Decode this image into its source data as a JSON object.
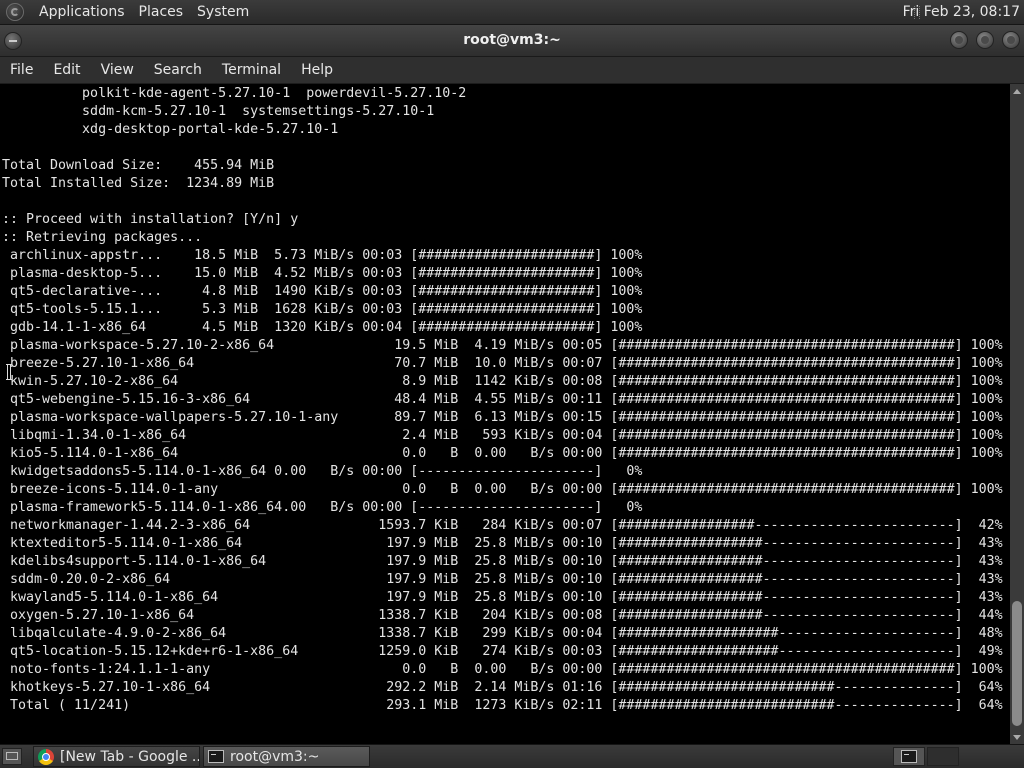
{
  "top_panel": {
    "menus": [
      "Applications",
      "Places",
      "System"
    ],
    "clock": "Fri Feb 23, 08:17"
  },
  "window": {
    "title": "root@vm3:~"
  },
  "menubar": {
    "items": [
      "File",
      "Edit",
      "View",
      "Search",
      "Terminal",
      "Help"
    ]
  },
  "terminal": {
    "lines": [
      "          polkit-kde-agent-5.27.10-1  powerdevil-5.27.10-2",
      "          sddm-kcm-5.27.10-1  systemsettings-5.27.10-1",
      "          xdg-desktop-portal-kde-5.27.10-1",
      "",
      "Total Download Size:    455.94 MiB",
      "Total Installed Size:  1234.89 MiB",
      "",
      ":: Proceed with installation? [Y/n] y",
      ":: Retrieving packages...",
      " archlinux-appstr...    18.5 MiB  5.73 MiB/s 00:03 [######################] 100%",
      " plasma-desktop-5...    15.0 MiB  4.52 MiB/s 00:03 [######################] 100%",
      " qt5-declarative-...     4.8 MiB  1490 KiB/s 00:03 [######################] 100%",
      " qt5-tools-5.15.1...     5.3 MiB  1628 KiB/s 00:03 [######################] 100%",
      " gdb-14.1-1-x86_64       4.5 MiB  1320 KiB/s 00:04 [######################] 100%",
      " plasma-workspace-5.27.10-2-x86_64               19.5 MiB  4.19 MiB/s 00:05 [##########################################] 100%",
      " breeze-5.27.10-1-x86_64                         70.7 MiB  10.0 MiB/s 00:07 [##########################################] 100%",
      " kwin-5.27.10-2-x86_64                            8.9 MiB  1142 KiB/s 00:08 [##########################################] 100%",
      " qt5-webengine-5.15.16-3-x86_64                  48.4 MiB  4.55 MiB/s 00:11 [##########################################] 100%",
      " plasma-workspace-wallpapers-5.27.10-1-any       89.7 MiB  6.13 MiB/s 00:15 [##########################################] 100%",
      " libqmi-1.34.0-1-x86_64                           2.4 MiB   593 KiB/s 00:04 [##########################################] 100%",
      " kio5-5.114.0-1-x86_64                            0.0   B  0.00   B/s 00:00 [##########################################] 100%",
      " kwidgetsaddons5-5.114.0-1-x86_64 0.00   B/s 00:00 [----------------------]   0%",
      " breeze-icons-5.114.0-1-any                       0.0   B  0.00   B/s 00:00 [##########################################] 100%",
      " plasma-framework5-5.114.0-1-x86_64.00   B/s 00:00 [----------------------]   0%",
      " networkmanager-1.44.2-3-x86_64                1593.7 KiB   284 KiB/s 00:07 [#################-------------------------]  42%",
      " ktexteditor5-5.114.0-1-x86_64                  197.9 MiB  25.8 MiB/s 00:10 [##################------------------------]  43%",
      " kdelibs4support-5.114.0-1-x86_64               197.9 MiB  25.8 MiB/s 00:10 [##################------------------------]  43%",
      " sddm-0.20.0-2-x86_64                           197.9 MiB  25.8 MiB/s 00:10 [##################------------------------]  43%",
      " kwayland5-5.114.0-1-x86_64                     197.9 MiB  25.8 MiB/s 00:10 [##################------------------------]  43%",
      " oxygen-5.27.10-1-x86_64                       1338.7 KiB   204 KiB/s 00:08 [##################------------------------]  44%",
      " libqalculate-4.9.0-2-x86_64                   1338.7 KiB   299 KiB/s 00:04 [####################----------------------]  48%",
      " qt5-location-5.15.12+kde+r6-1-x86_64          1259.0 KiB   274 KiB/s 00:03 [####################----------------------]  49%",
      " noto-fonts-1:24.1.1-1-any                        0.0   B  0.00   B/s 00:00 [##########################################] 100%",
      " khotkeys-5.27.10-1-x86_64                      292.2 MiB  2.14 MiB/s 01:16 [###########################---------------]  64%",
      " Total ( 11/241)                                293.1 MiB  1273 KiB/s 02:11 [###########################---------------]  64%"
    ]
  },
  "taskbar": {
    "tasks": [
      {
        "label": "[New Tab - Google ..."
      },
      {
        "label": "root@vm3:~"
      }
    ]
  }
}
